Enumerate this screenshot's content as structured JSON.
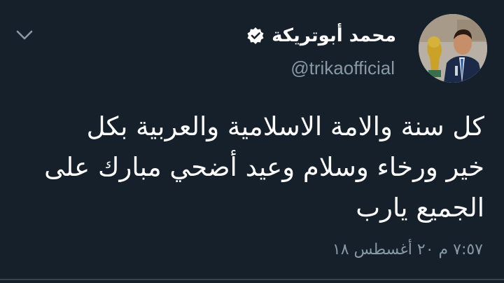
{
  "tweet": {
    "author_name": "محمد أبوتريكة",
    "handle": "@trikaofficial",
    "text_lines": [
      "كل سنة والامة الاسلامية والعربية بكل",
      "خير ورخاء وسلام وعيد أضحي مبارك على",
      "الجميع يارب"
    ],
    "timestamp": "٧:٥٧ م ٢٠ أغسطس ١٨"
  },
  "icons": {
    "menu": "chevron-down-icon",
    "verified": "verified-badge-icon"
  },
  "colors": {
    "background": "#15202b",
    "text": "#ffffff",
    "secondary_text": "#8899a6",
    "divider": "#38444d"
  }
}
